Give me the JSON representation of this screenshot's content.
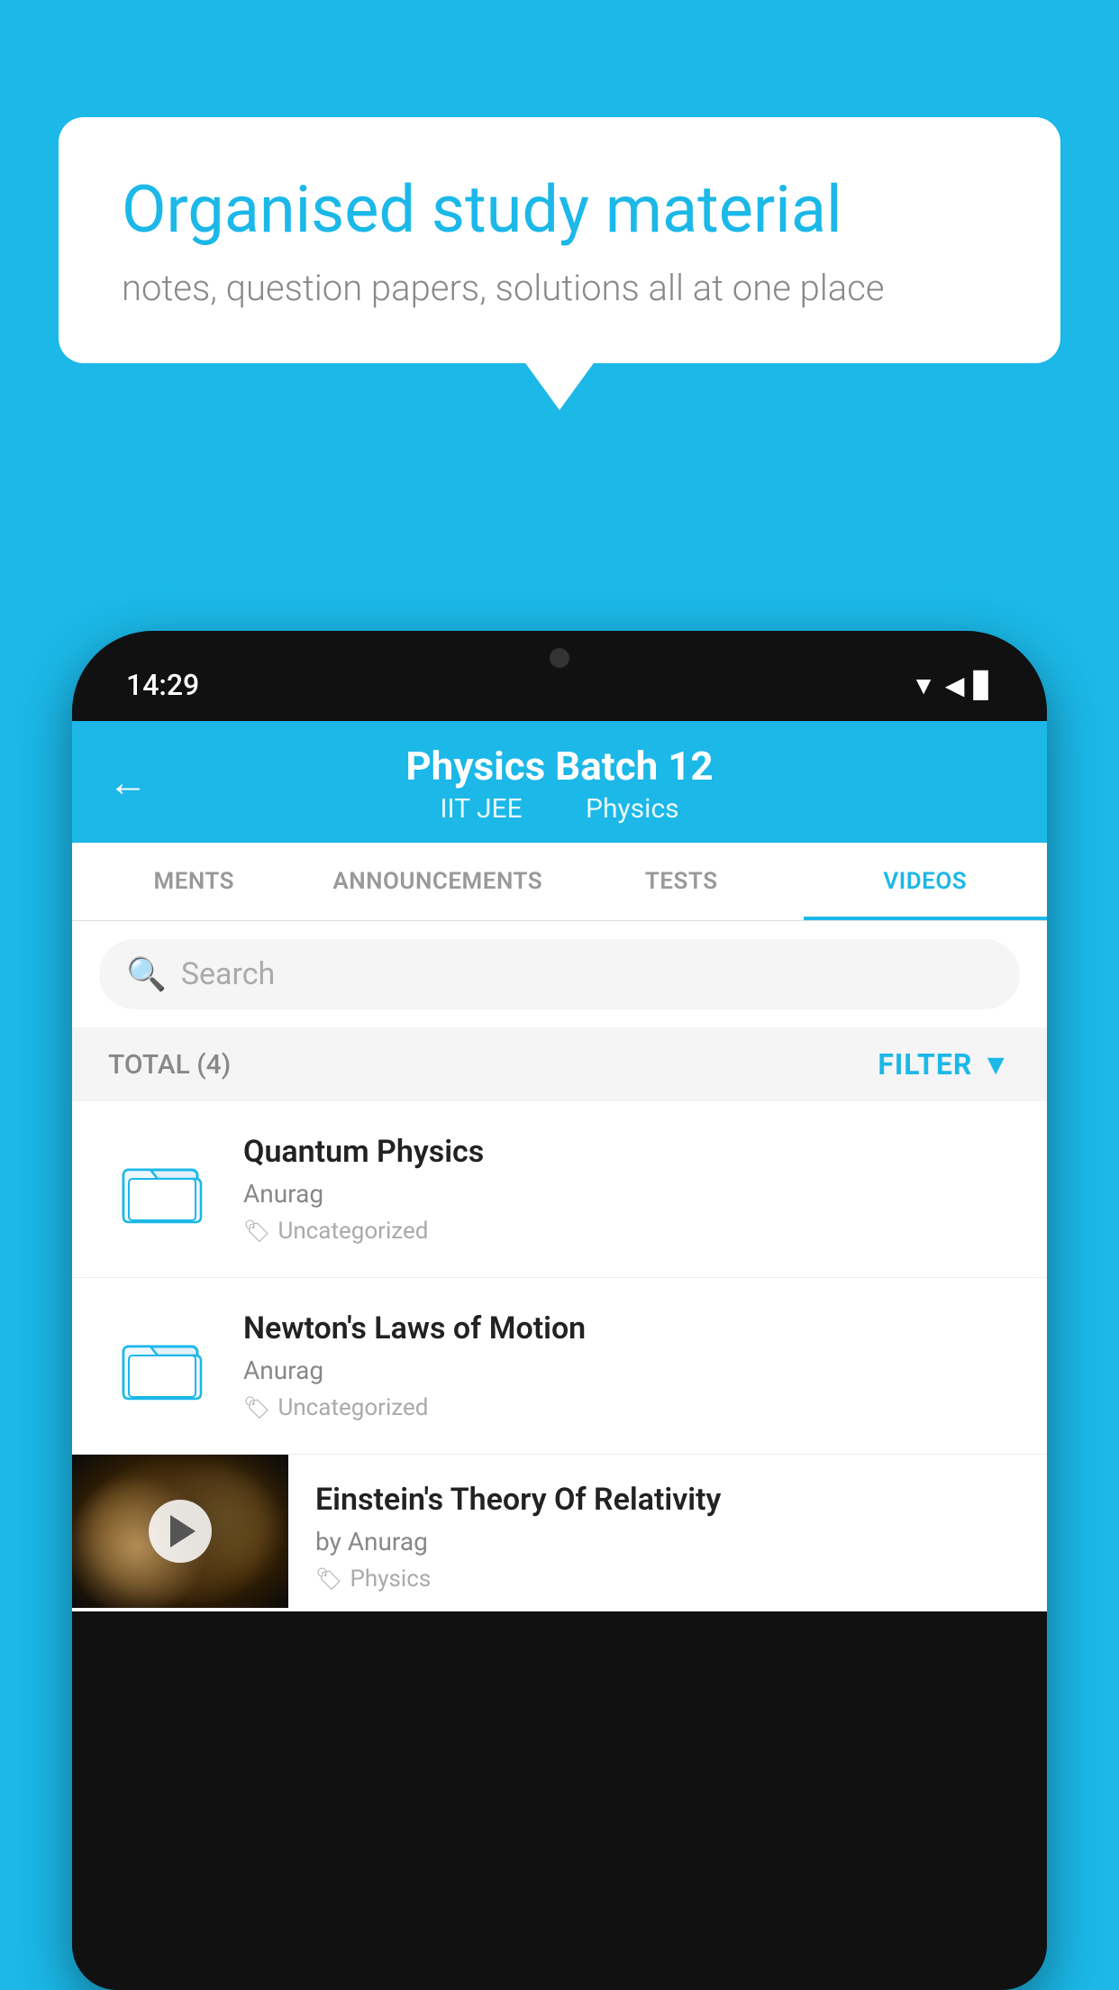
{
  "background_color": "#1bb8e8",
  "bubble": {
    "title": "Organised study material",
    "subtitle": "notes, question papers, solutions all at one place"
  },
  "status_bar": {
    "time": "14:29",
    "icons": [
      "▲",
      "▲",
      "▊"
    ]
  },
  "header": {
    "title": "Physics Batch 12",
    "subtitle_parts": [
      "IIT JEE",
      "Physics"
    ],
    "back_label": "←"
  },
  "tabs": [
    {
      "label": "MENTS",
      "active": false
    },
    {
      "label": "ANNOUNCEMENTS",
      "active": false
    },
    {
      "label": "TESTS",
      "active": false
    },
    {
      "label": "VIDEOS",
      "active": true
    }
  ],
  "search": {
    "placeholder": "Search"
  },
  "filter": {
    "total_label": "TOTAL (4)",
    "filter_label": "FILTER"
  },
  "videos": [
    {
      "title": "Quantum Physics",
      "author": "Anurag",
      "tag": "Uncategorized",
      "has_thumb": false
    },
    {
      "title": "Newton's Laws of Motion",
      "author": "Anurag",
      "tag": "Uncategorized",
      "has_thumb": false
    },
    {
      "title": "Einstein's Theory Of Relativity",
      "author": "by Anurag",
      "tag": "Physics",
      "has_thumb": true
    }
  ]
}
